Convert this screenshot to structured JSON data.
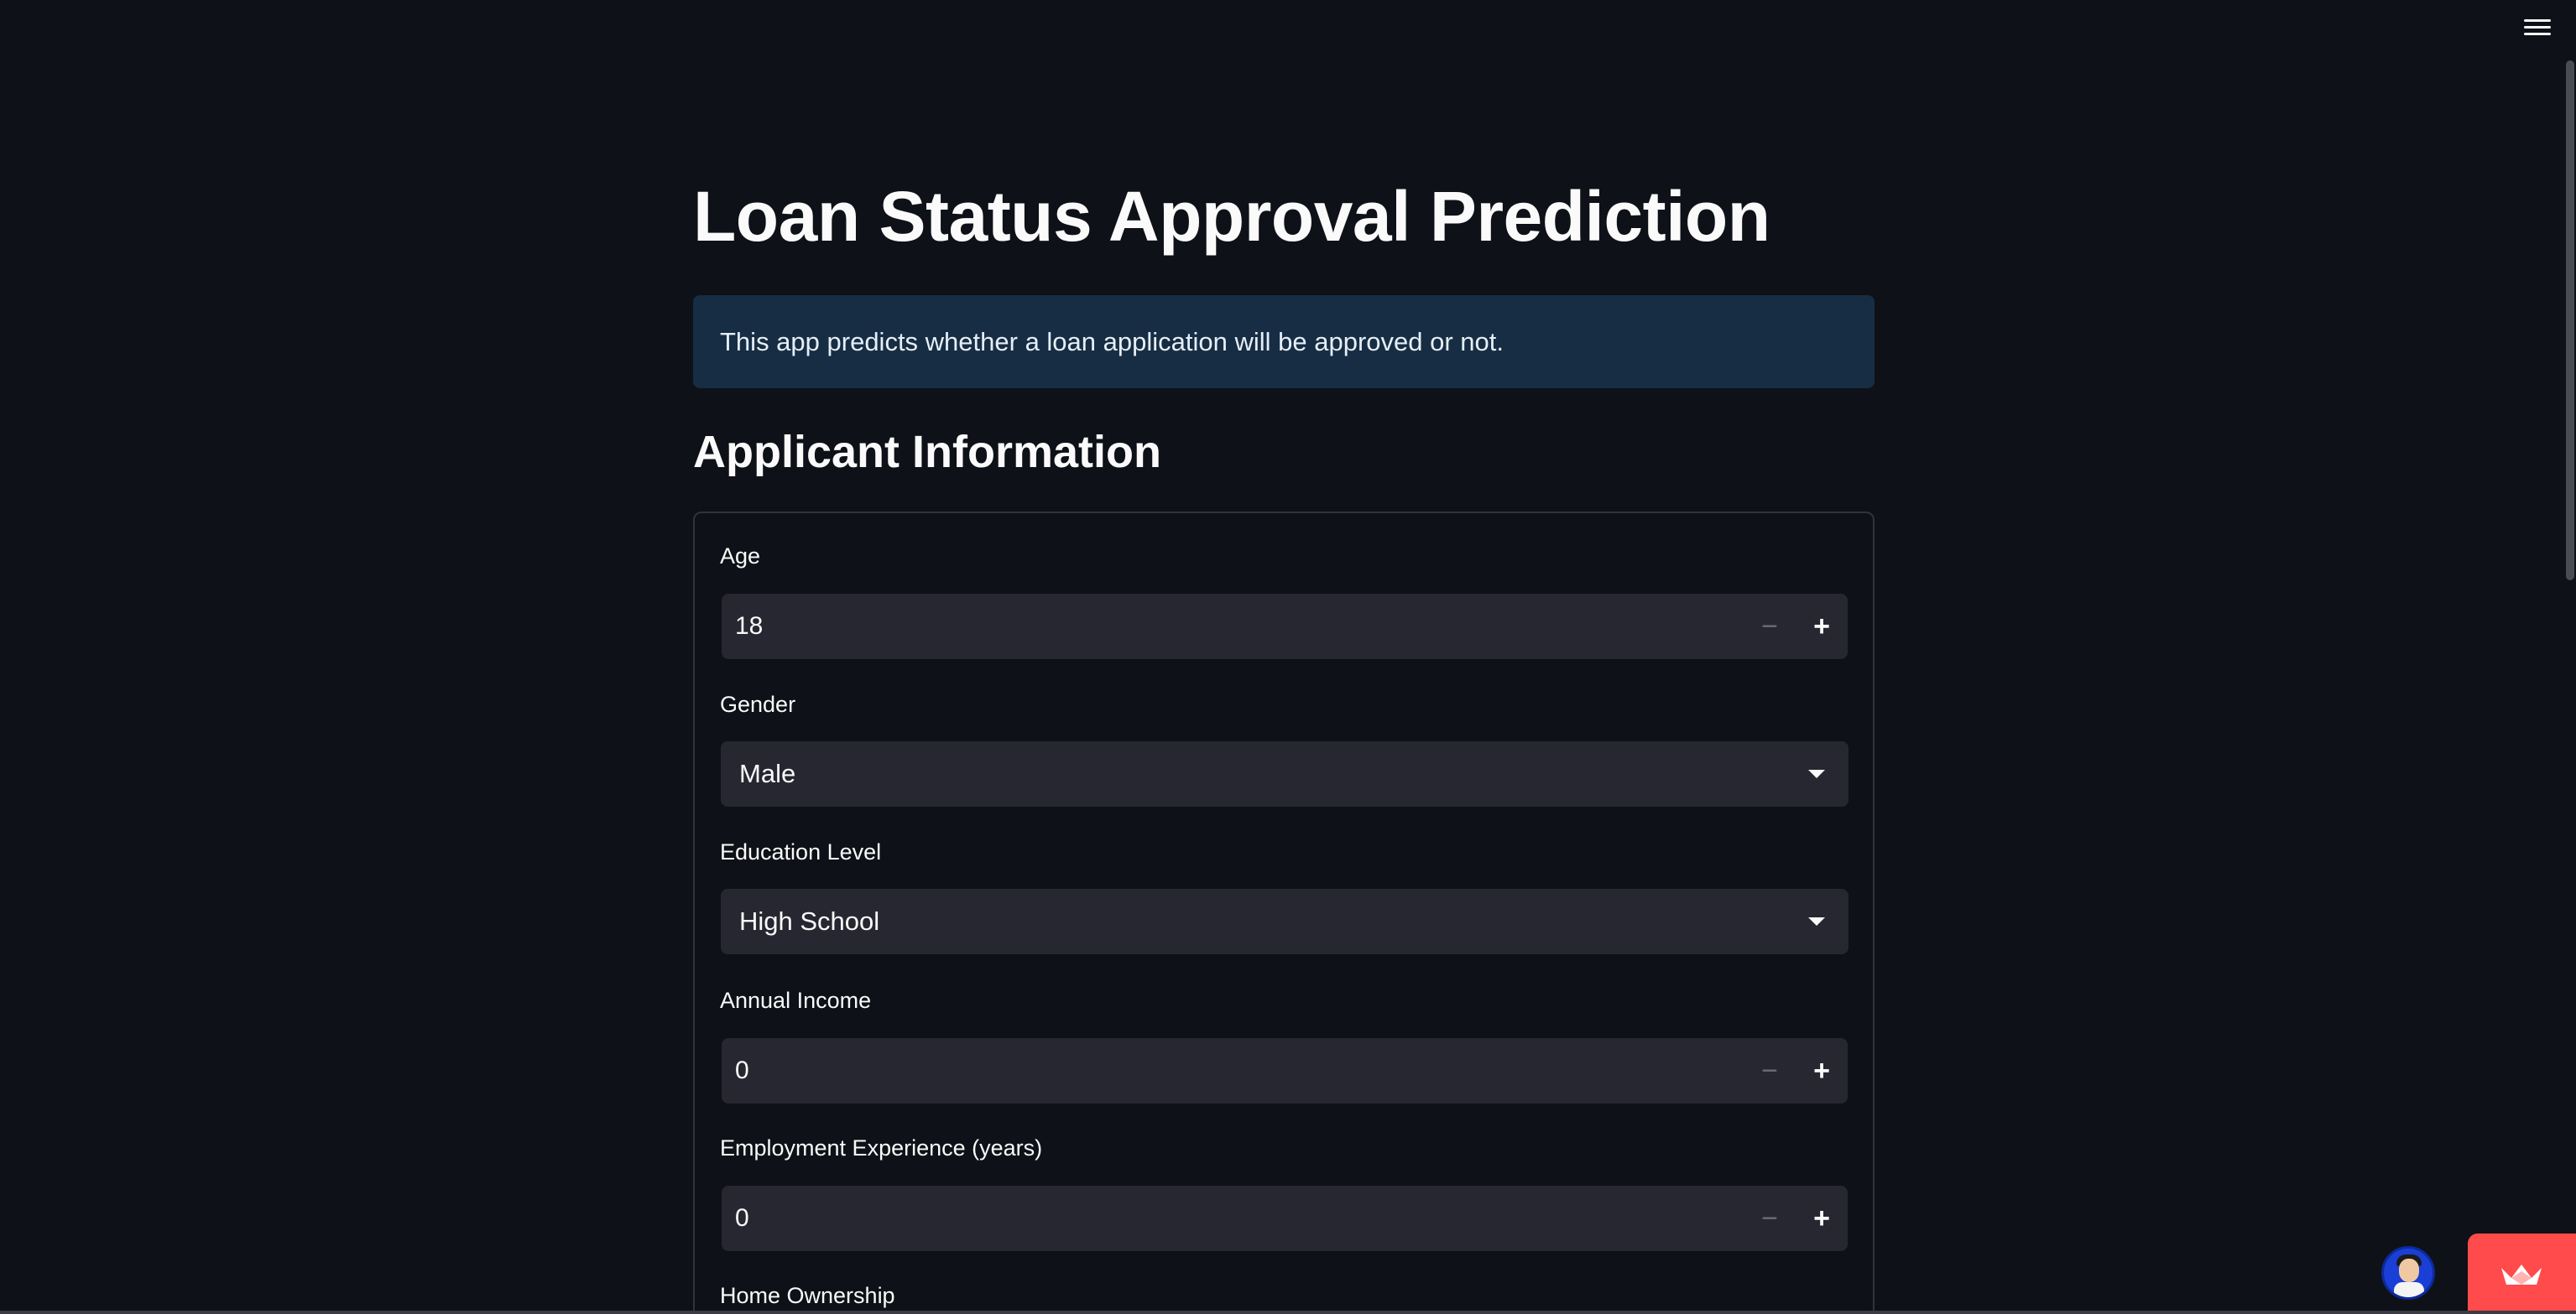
{
  "header": {
    "menu_icon": "hamburger-menu-icon"
  },
  "main": {
    "title": "Loan Status Approval Prediction",
    "info": "This app predicts whether a loan application will be approved or not.",
    "subheader": "Applicant Information"
  },
  "form": {
    "age": {
      "label": "Age",
      "value": "18"
    },
    "gender": {
      "label": "Gender",
      "value": "Male"
    },
    "education": {
      "label": "Education Level",
      "value": "High School"
    },
    "income": {
      "label": "Annual Income",
      "value": "0"
    },
    "experience": {
      "label": "Employment Experience (years)",
      "value": "0"
    },
    "home_ownership": {
      "label": "Home Ownership"
    },
    "minus_symbol": "−",
    "plus_symbol": "+"
  },
  "footer": {
    "avatar_icon": "user-avatar-icon",
    "badge_icon": "streamlit-crown-icon"
  },
  "colors": {
    "background": "#0e1117",
    "info_bg": "#172d43",
    "input_bg": "#262730",
    "accent": "#ff4b4b"
  }
}
